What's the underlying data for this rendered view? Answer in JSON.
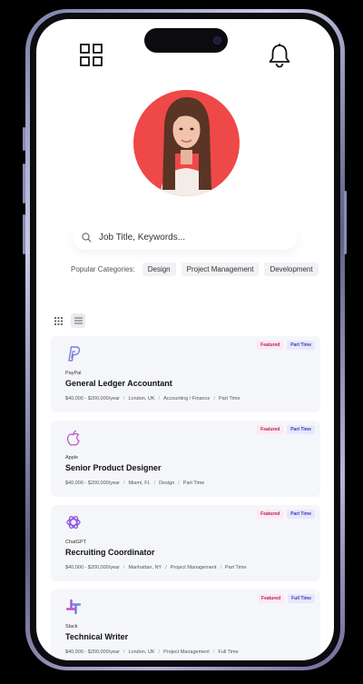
{
  "header": {
    "menu_icon": "grid-icon",
    "notification_icon": "bell-icon"
  },
  "profile": {
    "avatar_bg": "#ef4848"
  },
  "search": {
    "placeholder": "Job Title, Keywords..."
  },
  "categories": {
    "label": "Popular Categories:",
    "items": [
      "Design",
      "Project Management",
      "Development"
    ]
  },
  "view": {
    "grid_icon": "dots-grid-icon",
    "list_icon": "list-icon",
    "active": "list"
  },
  "jobs": [
    {
      "company": "PayPal",
      "title": "General Ledger Accountant",
      "salary": "$40,000 - $200,000/year",
      "location": "London, UK",
      "category": "Accounting / Finance",
      "type": "Part Time",
      "featured": "Featured",
      "logo": "paypal-logo"
    },
    {
      "company": "Apple",
      "title": "Senior Product Designer",
      "salary": "$40,000 - $200,000/year",
      "location": "Miami, FL",
      "category": "Design",
      "type": "Part Time",
      "featured": "Featured",
      "logo": "apple-logo"
    },
    {
      "company": "ChatGPT",
      "title": "Recruiting Coordinator",
      "salary": "$40,000 - $200,000/year",
      "location": "Manhattan, NY",
      "category": "Project Management",
      "type": "Part Time",
      "featured": "Featured",
      "logo": "chatgpt-logo"
    },
    {
      "company": "Slack",
      "title": "Technical Writer",
      "salary": "$40,000 - $200,000/year",
      "location": "London, UK",
      "category": "Project Management",
      "type": "Full Time",
      "featured": "Featured",
      "logo": "slack-logo"
    }
  ],
  "colors": {
    "featured": "#b4235a",
    "job_type": "#3a3fb8",
    "card_bg": "#f5f6fa",
    "accent": "#ef4848"
  }
}
